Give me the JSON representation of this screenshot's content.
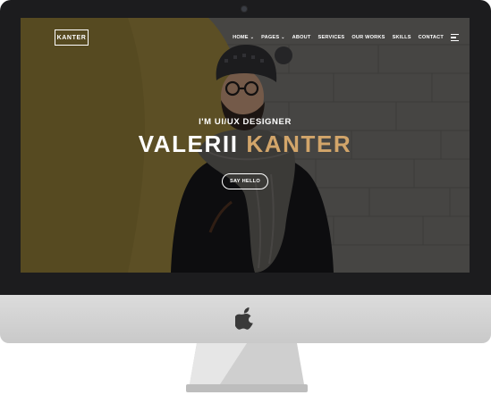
{
  "site": {
    "logo": "KANTER",
    "nav": [
      {
        "label": "HOME",
        "dropdown": true
      },
      {
        "label": "PAGES",
        "dropdown": true
      },
      {
        "label": "ABOUT",
        "dropdown": false
      },
      {
        "label": "SERVICES",
        "dropdown": false
      },
      {
        "label": "OUR WORKS",
        "dropdown": false
      },
      {
        "label": "SKILLS",
        "dropdown": false
      },
      {
        "label": "CONTACT",
        "dropdown": false
      }
    ],
    "menu_icon": "hamburger-menu-icon"
  },
  "hero": {
    "subtitle": "I'M UI/UX DESIGNER",
    "name_first": "VALERII",
    "name_last": "KANTER",
    "cta": "SAY HELLO",
    "accent_color": "#d2a56a"
  },
  "device": {
    "brand_icon": "apple-logo-icon"
  }
}
